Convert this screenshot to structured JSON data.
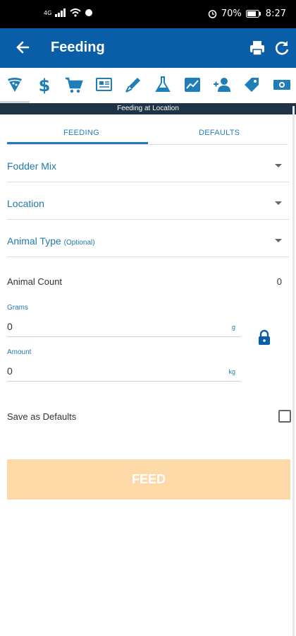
{
  "status_bar": {
    "network": "4G",
    "battery": "70%",
    "time": "8:27"
  },
  "app_bar": {
    "title": "Feeding",
    "back_icon": "arrow-left-icon",
    "print_icon": "printer-icon",
    "refresh_icon": "refresh-icon"
  },
  "icon_bar": {
    "items": [
      "pizza-slice-icon",
      "dollar-icon",
      "cart-icon",
      "newspaper-icon",
      "syringe-icon",
      "flask-icon",
      "chart-line-icon",
      "user-add-icon",
      "tag-icon",
      "money-bill-icon"
    ],
    "active_index": 0
  },
  "banner": "Feeding at Location",
  "tabs": [
    {
      "label": "FEEDING",
      "active": true
    },
    {
      "label": "DEFAULTS",
      "active": false
    }
  ],
  "fields": {
    "fodder_mix": "Fodder Mix",
    "location": "Location",
    "animal_type": "Animal Type",
    "animal_type_optional": "(Optional)"
  },
  "animal_count": {
    "label": "Animal Count",
    "value": "0"
  },
  "grams": {
    "label": "Grams",
    "value": "0",
    "unit": "g"
  },
  "amount": {
    "label": "Amount",
    "value": "0",
    "unit": "kg"
  },
  "save_defaults": {
    "label": "Save as Defaults",
    "checked": false
  },
  "feed_button": "FEED",
  "colors": {
    "primary": "#0a5ea8",
    "accent": "#1e7fb8",
    "banner": "#1f3347",
    "button_disabled": "#fdd9a8"
  }
}
